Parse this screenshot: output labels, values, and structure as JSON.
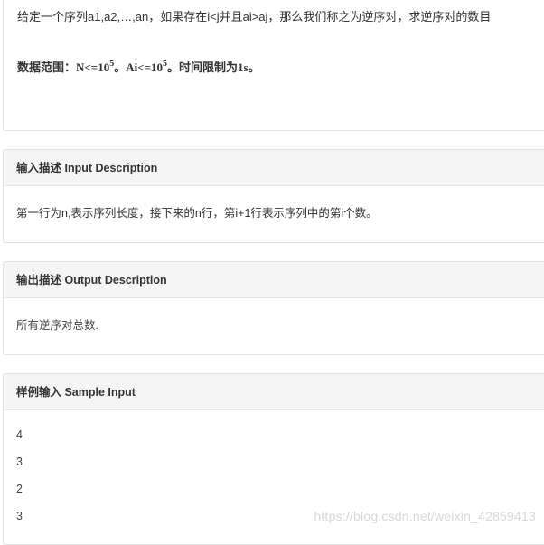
{
  "problem": {
    "description": "给定一个序列a1,a2,…,an，如果存在i<j并且ai>aj，那么我们称之为逆序对，求逆序对的数目",
    "range_prefix": "数据范围：N<=10",
    "range_exp1": "5",
    "range_mid": "。Ai<=10",
    "range_exp2": "5",
    "range_suffix": "。时间限制为1s。"
  },
  "input_section": {
    "title": "输入描述 Input Description",
    "body": "第一行为n,表示序列长度，接下来的n行，第i+1行表示序列中的第i个数。"
  },
  "output_section": {
    "title": "输出描述 Output Description",
    "body": "所有逆序对总数."
  },
  "sample_section": {
    "title": "样例输入 Sample Input",
    "lines": [
      "4",
      "3",
      "2",
      "3"
    ]
  },
  "watermark": "https://blog.csdn.net/weixin_42859413"
}
